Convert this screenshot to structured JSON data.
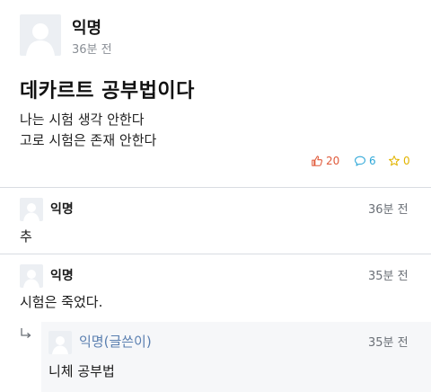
{
  "post": {
    "author": "익명",
    "time": "36분 전",
    "title": "데카르트 공부법이다",
    "body_lines": [
      "나는 시험 생각 안한다",
      "고로 시험은 존재 안한다"
    ],
    "likes": "20",
    "comments": "6",
    "scraps": "0"
  },
  "comments": [
    {
      "author": "익명",
      "time": "36분 전",
      "text": "추"
    },
    {
      "author": "익명",
      "time": "35분 전",
      "text": "시험은 죽었다."
    }
  ],
  "reply": {
    "author": "익명(글쓴이)",
    "time": "35분 전",
    "text": "니체 공부법"
  },
  "colors": {
    "like": "#e05a3a",
    "comment": "#2da7d8",
    "scrap": "#e2b400",
    "reply_author": "#5a7fb0"
  },
  "icons": {
    "like": "thumbs-up-icon",
    "comment": "speech-bubble-icon",
    "scrap": "star-icon",
    "reply": "reply-arrow-icon",
    "avatar": "default-avatar-icon"
  }
}
